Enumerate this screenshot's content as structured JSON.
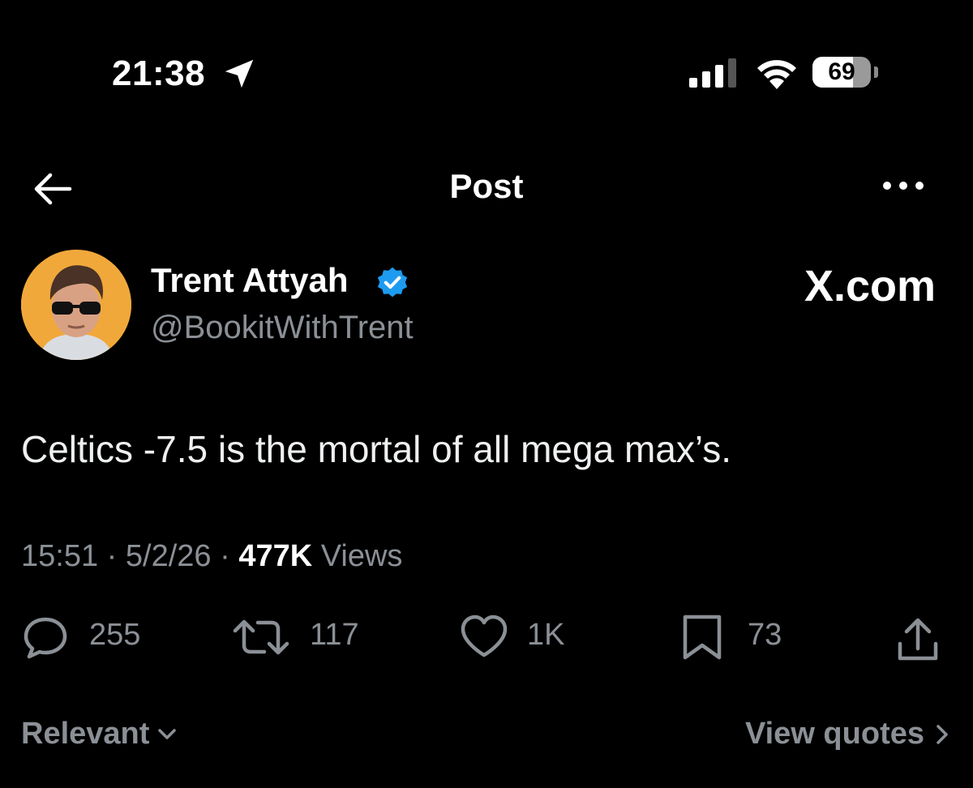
{
  "status_bar": {
    "time": "21:38",
    "battery_percent": 69,
    "battery_label": "69",
    "icons": [
      "location-arrow-icon",
      "cellular-signal-icon",
      "wifi-icon",
      "battery-icon"
    ]
  },
  "nav": {
    "title": "Post",
    "back_icon": "arrow-left-icon",
    "more_icon": "more-horizontal-icon"
  },
  "author": {
    "name": "Trent Attyah",
    "handle": "@BookitWithTrent",
    "verified": true,
    "verified_color": "#1d9bf0"
  },
  "watermark": "X.com",
  "post": {
    "text": "Celtics -7.5 is the mortal of all mega max’s.",
    "time": "15:51",
    "date": "5/2/26",
    "separator": "·",
    "views_count": "477K",
    "views_label": "Views"
  },
  "actions": {
    "replies": "255",
    "reposts": "117",
    "likes": "1K",
    "bookmarks": "73"
  },
  "footer": {
    "sort_label": "Relevant",
    "view_quotes_label": "View quotes"
  },
  "colors": {
    "background": "#000000",
    "primary_text": "#e7e9ea",
    "secondary_text": "#8b9096",
    "avatar_background": "#f1a83b"
  }
}
